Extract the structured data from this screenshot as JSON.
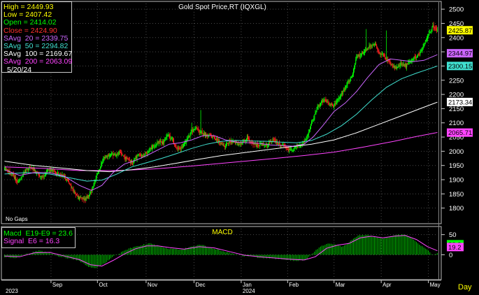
{
  "chart_data": [
    {
      "type": "candlestick",
      "title": "Gold  Spot  Price,RT  (IQXGL)",
      "ylim": [
        1750,
        2520
      ],
      "yticks": [
        2500,
        2450,
        2400,
        2350,
        2300,
        2250,
        2200,
        2150,
        2100,
        2050,
        2000,
        1950,
        1900,
        1850,
        1800
      ],
      "grid": true,
      "months": [
        "Sep",
        "Oct",
        "Nov",
        "Dec",
        "Jan",
        "Feb",
        "Mar",
        "Apr",
        "May"
      ],
      "years": [
        "2023",
        "2024"
      ],
      "time_unit": "Day",
      "no_gaps_label": "No  Gaps",
      "legend": {
        "date": "5/20/24",
        "rows": [
          {
            "label": "High",
            "value": "2449.93",
            "color": "#ffff00"
          },
          {
            "label": "Low",
            "value": "2407.42",
            "color": "#ffff00"
          },
          {
            "label": "Open",
            "value": "2414.02",
            "color": "#00ff00"
          },
          {
            "label": "Close",
            "value": "2424.90",
            "color": "#ff3030"
          },
          {
            "label": "SAvg  20",
            "value": "2339.75",
            "color": "#cc66ff"
          },
          {
            "label": "SAvg  50",
            "value": "2294.82",
            "color": "#40e0d0"
          },
          {
            "label": "SAvg  100",
            "value": "2169.67",
            "color": "#ffffff"
          },
          {
            "label": "SAvg  200",
            "value": "2063.09",
            "color": "#ff44ff"
          }
        ]
      },
      "price_tags": [
        {
          "value": "2425.87",
          "color": "#ffff00"
        },
        {
          "value": "2344.97",
          "color": "#cc66ff"
        },
        {
          "value": "2300.15",
          "color": "#40e0d0"
        },
        {
          "value": "2173.34",
          "color": "#ffffff"
        },
        {
          "value": "2065.71",
          "color": "#ff44ff"
        }
      ],
      "close_anchors": [
        [
          0,
          1940
        ],
        [
          10,
          1920
        ],
        [
          18,
          1890
        ],
        [
          26,
          1925
        ],
        [
          34,
          1945
        ],
        [
          42,
          1930
        ],
        [
          50,
          1905
        ],
        [
          58,
          1935
        ],
        [
          66,
          1930
        ],
        [
          74,
          1915
        ],
        [
          80,
          1910
        ],
        [
          86,
          1890
        ],
        [
          92,
          1860
        ],
        [
          100,
          1835
        ],
        [
          108,
          1830
        ],
        [
          116,
          1860
        ],
        [
          124,
          1920
        ],
        [
          132,
          1975
        ],
        [
          140,
          1990
        ],
        [
          148,
          1985
        ],
        [
          155,
          1995
        ],
        [
          162,
          1975
        ],
        [
          170,
          1960
        ],
        [
          178,
          1985
        ],
        [
          186,
          1985
        ],
        [
          193,
          2005
        ],
        [
          200,
          2020
        ],
        [
          206,
          2035
        ],
        [
          212,
          2030
        ],
        [
          218,
          2055
        ],
        [
          224,
          2040
        ],
        [
          230,
          2010
        ],
        [
          236,
          2010
        ],
        [
          242,
          2035
        ],
        [
          250,
          2070
        ],
        [
          256,
          2085
        ],
        [
          262,
          2065
        ],
        [
          268,
          2060
        ],
        [
          275,
          2055
        ],
        [
          282,
          2045
        ],
        [
          288,
          2030
        ],
        [
          294,
          2015
        ],
        [
          300,
          2035
        ],
        [
          306,
          2030
        ],
        [
          312,
          2025
        ],
        [
          318,
          2030
        ],
        [
          324,
          2050
        ],
        [
          330,
          2030
        ],
        [
          336,
          2020
        ],
        [
          342,
          2025
        ],
        [
          348,
          2020
        ],
        [
          354,
          2030
        ],
        [
          360,
          2040
        ],
        [
          366,
          2025
        ],
        [
          372,
          2020
        ],
        [
          378,
          2005
        ],
        [
          384,
          2000
        ],
        [
          390,
          2020
        ],
        [
          396,
          2025
        ],
        [
          402,
          2040
        ],
        [
          410,
          2100
        ],
        [
          418,
          2155
        ],
        [
          426,
          2180
        ],
        [
          432,
          2170
        ],
        [
          440,
          2160
        ],
        [
          446,
          2185
        ],
        [
          452,
          2210
        ],
        [
          458,
          2240
        ],
        [
          464,
          2265
        ],
        [
          470,
          2330
        ],
        [
          476,
          2340
        ],
        [
          482,
          2355
        ],
        [
          488,
          2370
        ],
        [
          494,
          2380
        ],
        [
          500,
          2345
        ],
        [
          506,
          2340
        ],
        [
          512,
          2320
        ],
        [
          518,
          2300
        ],
        [
          524,
          2295
        ],
        [
          530,
          2310
        ],
        [
          536,
          2300
        ],
        [
          542,
          2320
        ],
        [
          548,
          2330
        ],
        [
          554,
          2340
        ],
        [
          560,
          2375
        ],
        [
          566,
          2410
        ],
        [
          572,
          2440
        ],
        [
          578,
          2425
        ]
      ],
      "sma20_anchors": [
        [
          0,
          1935
        ],
        [
          20,
          1915
        ],
        [
          40,
          1925
        ],
        [
          60,
          1925
        ],
        [
          80,
          1912
        ],
        [
          100,
          1880
        ],
        [
          116,
          1862
        ],
        [
          130,
          1880
        ],
        [
          145,
          1925
        ],
        [
          160,
          1955
        ],
        [
          175,
          1968
        ],
        [
          190,
          1985
        ],
        [
          205,
          2005
        ],
        [
          220,
          2025
        ],
        [
          235,
          2030
        ],
        [
          250,
          2040
        ],
        [
          265,
          2055
        ],
        [
          280,
          2055
        ],
        [
          295,
          2040
        ],
        [
          310,
          2032
        ],
        [
          325,
          2030
        ],
        [
          340,
          2028
        ],
        [
          355,
          2022
        ],
        [
          370,
          2020
        ],
        [
          385,
          2018
        ],
        [
          400,
          2025
        ],
        [
          412,
          2050
        ],
        [
          425,
          2090
        ],
        [
          440,
          2140
        ],
        [
          455,
          2170
        ],
        [
          470,
          2210
        ],
        [
          485,
          2260
        ],
        [
          500,
          2305
        ],
        [
          515,
          2325
        ],
        [
          530,
          2320
        ],
        [
          545,
          2315
        ],
        [
          560,
          2320
        ],
        [
          578,
          2340
        ]
      ],
      "sma50_anchors": [
        [
          0,
          1920
        ],
        [
          30,
          1925
        ],
        [
          60,
          1920
        ],
        [
          90,
          1905
        ],
        [
          110,
          1895
        ],
        [
          130,
          1898
        ],
        [
          150,
          1920
        ],
        [
          170,
          1945
        ],
        [
          190,
          1960
        ],
        [
          210,
          1975
        ],
        [
          230,
          1992
        ],
        [
          250,
          2010
        ],
        [
          270,
          2025
        ],
        [
          290,
          2035
        ],
        [
          310,
          2038
        ],
        [
          330,
          2036
        ],
        [
          350,
          2035
        ],
        [
          370,
          2032
        ],
        [
          390,
          2030
        ],
        [
          410,
          2038
        ],
        [
          430,
          2060
        ],
        [
          450,
          2090
        ],
        [
          470,
          2130
        ],
        [
          490,
          2180
        ],
        [
          510,
          2225
        ],
        [
          530,
          2255
        ],
        [
          550,
          2275
        ],
        [
          565,
          2288
        ],
        [
          578,
          2300
        ]
      ],
      "sma100_anchors": [
        [
          0,
          1965
        ],
        [
          40,
          1950
        ],
        [
          80,
          1940
        ],
        [
          110,
          1932
        ],
        [
          140,
          1928
        ],
        [
          170,
          1935
        ],
        [
          200,
          1945
        ],
        [
          230,
          1958
        ],
        [
          260,
          1972
        ],
        [
          290,
          1985
        ],
        [
          320,
          1995
        ],
        [
          350,
          2005
        ],
        [
          380,
          2015
        ],
        [
          410,
          2025
        ],
        [
          440,
          2040
        ],
        [
          470,
          2065
        ],
        [
          500,
          2095
        ],
        [
          530,
          2125
        ],
        [
          560,
          2155
        ],
        [
          578,
          2173
        ]
      ],
      "sma200_anchors": [
        [
          0,
          1945
        ],
        [
          50,
          1940
        ],
        [
          100,
          1932
        ],
        [
          150,
          1932
        ],
        [
          200,
          1938
        ],
        [
          250,
          1948
        ],
        [
          300,
          1960
        ],
        [
          350,
          1972
        ],
        [
          400,
          1985
        ],
        [
          440,
          1997
        ],
        [
          480,
          2015
        ],
        [
          520,
          2035
        ],
        [
          550,
          2052
        ],
        [
          578,
          2066
        ]
      ]
    },
    {
      "type": "bar",
      "title": "MACD",
      "ylim": [
        -60,
        65
      ],
      "yticks": [
        50,
        0
      ],
      "legend": [
        {
          "label": "Macd  E19-E9",
          "value": "23.6",
          "color": "#00ff00"
        },
        {
          "label": "Signal  E6",
          "value": "16.3",
          "color": "#ff44ff"
        }
      ],
      "price_tags": [
        {
          "value": "26.2",
          "color": "#00ff00"
        },
        {
          "value": "19.2",
          "color": "#ff44ff"
        }
      ],
      "macd_anchors": [
        [
          0,
          -5
        ],
        [
          15,
          -8
        ],
        [
          30,
          2
        ],
        [
          45,
          10
        ],
        [
          60,
          5
        ],
        [
          75,
          -5
        ],
        [
          90,
          -10
        ],
        [
          100,
          -15
        ],
        [
          110,
          -28
        ],
        [
          120,
          -33
        ],
        [
          128,
          -28
        ],
        [
          136,
          -18
        ],
        [
          145,
          -5
        ],
        [
          155,
          5
        ],
        [
          165,
          15
        ],
        [
          175,
          20
        ],
        [
          185,
          25
        ],
        [
          195,
          28
        ],
        [
          205,
          22
        ],
        [
          220,
          15
        ],
        [
          235,
          12
        ],
        [
          250,
          20
        ],
        [
          262,
          25
        ],
        [
          275,
          18
        ],
        [
          290,
          10
        ],
        [
          305,
          2
        ],
        [
          320,
          -3
        ],
        [
          335,
          -6
        ],
        [
          350,
          -8
        ],
        [
          365,
          -10
        ],
        [
          380,
          -13
        ],
        [
          392,
          -15
        ],
        [
          402,
          -12
        ],
        [
          412,
          5
        ],
        [
          422,
          20
        ],
        [
          432,
          28
        ],
        [
          442,
          26
        ],
        [
          452,
          20
        ],
        [
          462,
          35
        ],
        [
          472,
          48
        ],
        [
          482,
          50
        ],
        [
          492,
          45
        ],
        [
          505,
          40
        ],
        [
          515,
          45
        ],
        [
          525,
          50
        ],
        [
          535,
          50
        ],
        [
          545,
          40
        ],
        [
          555,
          25
        ],
        [
          565,
          12
        ],
        [
          572,
          -2
        ],
        [
          578,
          5
        ]
      ],
      "signal_anchors": [
        [
          0,
          -3
        ],
        [
          20,
          -5
        ],
        [
          40,
          5
        ],
        [
          60,
          6
        ],
        [
          80,
          -3
        ],
        [
          100,
          -12
        ],
        [
          115,
          -25
        ],
        [
          130,
          -28
        ],
        [
          145,
          -14
        ],
        [
          160,
          2
        ],
        [
          175,
          15
        ],
        [
          190,
          22
        ],
        [
          205,
          22
        ],
        [
          220,
          18
        ],
        [
          240,
          14
        ],
        [
          260,
          20
        ],
        [
          280,
          17
        ],
        [
          300,
          8
        ],
        [
          320,
          -1
        ],
        [
          340,
          -5
        ],
        [
          360,
          -8
        ],
        [
          380,
          -11
        ],
        [
          400,
          -13
        ],
        [
          415,
          -5
        ],
        [
          430,
          16
        ],
        [
          445,
          24
        ],
        [
          460,
          28
        ],
        [
          475,
          42
        ],
        [
          490,
          46
        ],
        [
          505,
          42
        ],
        [
          520,
          46
        ],
        [
          535,
          48
        ],
        [
          550,
          38
        ],
        [
          565,
          20
        ],
        [
          578,
          10
        ]
      ]
    }
  ]
}
